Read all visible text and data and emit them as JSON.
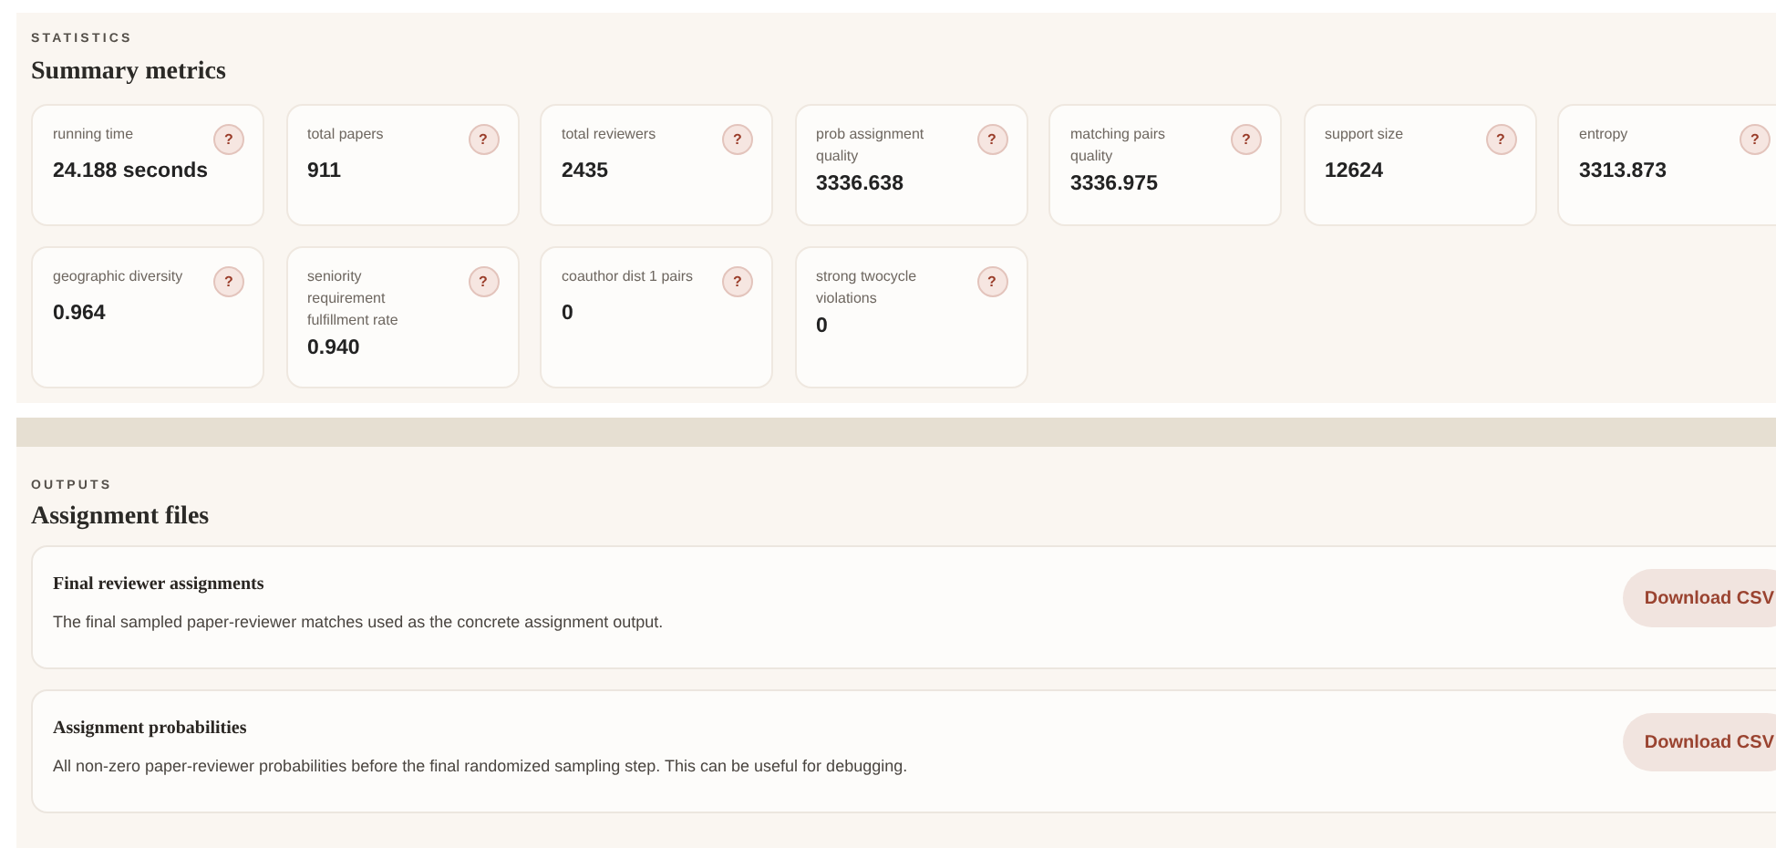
{
  "statistics": {
    "eyebrow": "STATISTICS",
    "title": "Summary metrics",
    "help_glyph": "?",
    "metrics": [
      {
        "label": "running time",
        "value": "24.188 seconds"
      },
      {
        "label": "total papers",
        "value": "911"
      },
      {
        "label": "total reviewers",
        "value": "2435"
      },
      {
        "label": "prob assignment quality",
        "value": "3336.638"
      },
      {
        "label": "matching pairs quality",
        "value": "3336.975"
      },
      {
        "label": "support size",
        "value": "12624"
      },
      {
        "label": "entropy",
        "value": "3313.873"
      },
      {
        "label": "geographic diversity",
        "value": "0.964"
      },
      {
        "label": "seniority requirement fulfillment rate",
        "value": "0.940"
      },
      {
        "label": "coauthor dist 1 pairs",
        "value": "0"
      },
      {
        "label": "strong twocycle violations",
        "value": "0"
      }
    ]
  },
  "outputs": {
    "eyebrow": "OUTPUTS",
    "title": "Assignment files",
    "files": [
      {
        "title": "Final reviewer assignments",
        "description": "The final sampled paper-reviewer matches used as the concrete assignment output.",
        "button": "Download CSV"
      },
      {
        "title": "Assignment probabilities",
        "description": "All non-zero paper-reviewer probabilities before the final randomized sampling step. This can be useful for debugging.",
        "button": "Download CSV"
      }
    ]
  }
}
